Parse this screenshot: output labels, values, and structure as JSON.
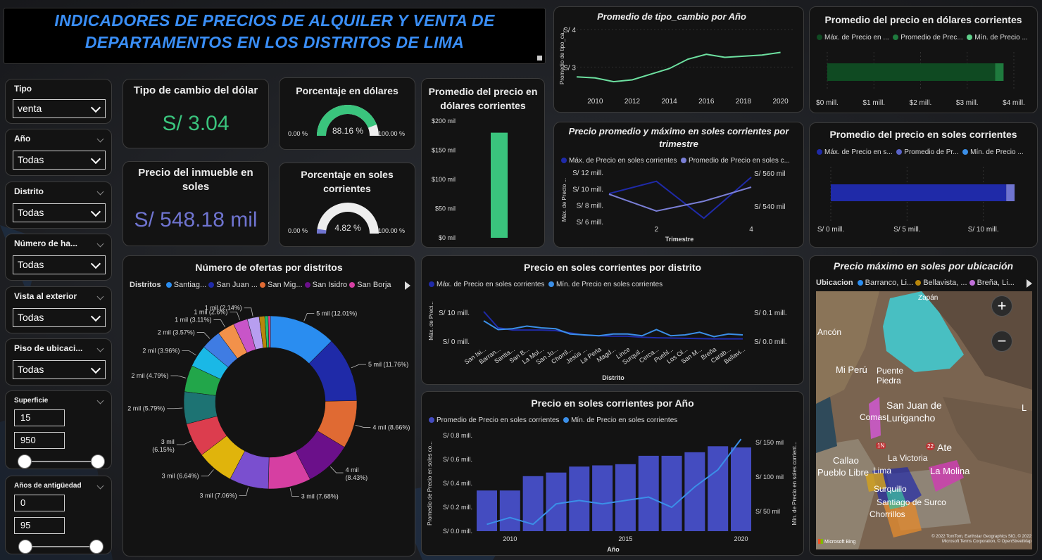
{
  "header": {
    "title_line1": "INDICADORES DE PRECIOS DE ALQUILER Y VENTA DE",
    "title_line2": "DEPARTAMENTOS EN LOS DISTRITOS DE LIMA"
  },
  "slicers": [
    {
      "label": "Tipo",
      "value": "venta"
    },
    {
      "label": "Año",
      "value": "Todas"
    },
    {
      "label": "Distrito",
      "value": "Todas"
    },
    {
      "label": "Número de ha...",
      "value": "Todas"
    },
    {
      "label": "Vista al exterior",
      "value": "Todas"
    },
    {
      "label": "Piso de ubicaci...",
      "value": "Todas"
    }
  ],
  "ranges": [
    {
      "label": "Superficie",
      "min": "15",
      "max": "950"
    },
    {
      "label": "Años de antigüedad",
      "min": "0",
      "max": "95"
    }
  ],
  "kpi": {
    "tc_title": "Tipo de cambio del dólar",
    "tc_value": "S/ 3.04",
    "price_title": "Precio del inmueble en soles",
    "price_value": "S/ 548.18 mil"
  },
  "gauges": {
    "usd": {
      "title": "Porcentaje en dólares",
      "value": "88.16 %",
      "fraction": 0.8816,
      "min": "0.00 %",
      "max": "100.00 %"
    },
    "pen": {
      "title": "Porcentaje en soles corrientes",
      "value": "4.82 %",
      "fraction": 0.0482,
      "min": "0.00 %",
      "max": "100.00 %"
    }
  },
  "colors": {
    "green": "#3ac47d",
    "blue": "#2e3bb5",
    "lightblue": "#3b8fe8",
    "purple": "#7a7fd6",
    "cyan": "#6de0a0"
  },
  "chart_data": [
    {
      "id": "usd_bar",
      "type": "bar",
      "title": "Promedio del precio en dólares corrientes",
      "yticks": [
        "$200 mil",
        "$150 mil",
        "$100 mil",
        "$50 mil",
        "$0 mil"
      ],
      "ylim": [
        0,
        200
      ],
      "values": [
        180
      ]
    },
    {
      "id": "tc_line",
      "type": "line",
      "title": "Promedio de tipo_cambio por Año",
      "ylabel": "Promedio de tipo_ca...",
      "yticks": [
        "S/ 4",
        "S/ 3"
      ],
      "ylim": [
        2.5,
        4
      ],
      "xticks": [
        "2010",
        "2012",
        "2014",
        "2016",
        "2018",
        "2020"
      ],
      "x": [
        2009,
        2010,
        2011,
        2012,
        2013,
        2014,
        2015,
        2016,
        2017,
        2018,
        2019,
        2020
      ],
      "y": [
        2.74,
        2.71,
        2.61,
        2.66,
        2.81,
        2.96,
        3.21,
        3.34,
        3.26,
        3.29,
        3.32,
        3.39
      ]
    },
    {
      "id": "usd_hbar",
      "type": "bar",
      "title": "Promedio del precio en dólares corrientes",
      "legend": [
        "Máx. de Precio en ...",
        "Promedio de Prec...",
        "Mín. de Precio ..."
      ],
      "xticks": [
        "$0 mill.",
        "$1 mill.",
        "$2 mill.",
        "$3 mill.",
        "$4 mill."
      ],
      "xlim": [
        0,
        4
      ],
      "values": [
        3.6,
        0.18
      ]
    },
    {
      "id": "trim_line",
      "type": "line",
      "title": "Precio promedio y máximo en soles corrientes por trimestre",
      "legend": [
        "Máx. de Precio en soles corrientes",
        "Promedio de Precio en soles c..."
      ],
      "xlabel": "Trimestre",
      "ylabel": "Máx. de Precio ...",
      "yticks_left": [
        "S/ 12 mill.",
        "S/ 10 mill.",
        "S/ 8 mill.",
        "S/ 6 mill."
      ],
      "yticks_right": [
        "S/ 560 mil",
        "S/ 540 mil"
      ],
      "xticks": [
        "2",
        "4"
      ],
      "x": [
        1,
        2,
        3,
        4
      ],
      "series": [
        {
          "name": "Máx. de Precio en soles corrientes",
          "values": [
            9.5,
            11,
            6.5,
            11.5
          ]
        },
        {
          "name": "Promedio de Precio en soles c...",
          "values": [
            550,
            538,
            545,
            555
          ]
        }
      ]
    },
    {
      "id": "pen_hbar",
      "type": "bar",
      "title": "Promedio del precio en soles corrientes",
      "legend": [
        "Máx. de Precio en s...",
        "Promedio de Pr...",
        "Mín. de Precio ..."
      ],
      "xticks": [
        "S/ 0 mill.",
        "S/ 5 mill.",
        "S/ 10 mill."
      ],
      "xlim": [
        0,
        12
      ],
      "values": [
        11.5,
        0.55
      ]
    },
    {
      "id": "donut",
      "type": "pie",
      "title": "Número de ofertas por distritos",
      "legend_title": "Distritos",
      "legend": [
        "Santiag...",
        "San Juan ...",
        "San Mig...",
        "San Isidro",
        "San Borja"
      ],
      "slices": [
        {
          "label": "5 mil (12.01%)",
          "value": 12.01,
          "color": "#2a8df0"
        },
        {
          "label": "5 mil (11.76%)",
          "value": 11.76,
          "color": "#1f2aa8"
        },
        {
          "label": "4 mil (8.66%)",
          "value": 8.66,
          "color": "#e06a33"
        },
        {
          "label": "4 mil (8.43%)",
          "value": 8.43,
          "color": "#6b108a"
        },
        {
          "label": "3 mil (7.68%)",
          "value": 7.68,
          "color": "#d63fa2"
        },
        {
          "label": "3 mil (7.06%)",
          "value": 7.06,
          "color": "#7a4fcf"
        },
        {
          "label": "3 mil (6.64%)",
          "value": 6.64,
          "color": "#e0b40c"
        },
        {
          "label": "3 mil (6.15%)",
          "value": 6.15,
          "color": "#dc3d4e"
        },
        {
          "label": "2 mil (5.79%)",
          "value": 5.79,
          "color": "#1d7373"
        },
        {
          "label": "2 mil (4.79%)",
          "value": 4.79,
          "color": "#22a64a"
        },
        {
          "label": "2 mil (3.96%)",
          "value": 3.96,
          "color": "#1ab8e6"
        },
        {
          "label": "2 mil (3.57%)",
          "value": 3.57,
          "color": "#3f7ce3"
        },
        {
          "label": "1 mil (3.11%)",
          "value": 3.11,
          "color": "#f2914a"
        },
        {
          "label": "1 mil (2.6%)",
          "value": 2.6,
          "color": "#c855c8"
        },
        {
          "label": "1 mil (2.14%)",
          "value": 2.14,
          "color": "#b79ef0"
        },
        {
          "label": "",
          "value": 1.0,
          "color": "#b8860b"
        },
        {
          "label": "",
          "value": 0.6,
          "color": "#20c070"
        },
        {
          "label": "",
          "value": 0.4,
          "color": "#e83e8c"
        }
      ]
    },
    {
      "id": "dist_line",
      "type": "line",
      "title": "Precio en soles corrientes por distrito",
      "legend": [
        "Máx. de Precio en soles corrientes",
        "Mín. de Precio en soles corrientes"
      ],
      "xlabel": "Distrito",
      "ylabel": "Máx. de Preci...",
      "yticks_left": [
        "S/ 10 mill.",
        "S/ 0 mill."
      ],
      "yticks_right": [
        "S/ 0.1 mill.",
        "S/ 0.0 mill."
      ],
      "categories": [
        "San Isi...",
        "Barran...",
        "Santia...",
        "San B...",
        "La Mol...",
        "San Ju...",
        "Chorril...",
        "Jesús ...",
        "La Perla",
        "Magd...",
        "Lince",
        "Surquil...",
        "Cerca...",
        "Puebl...",
        "Los Ol...",
        "San M...",
        "Breña",
        "Carab...",
        "Bellavi..."
      ],
      "series": [
        {
          "name": "Máx. de Precio en soles corrientes",
          "values": [
            11.8,
            5.5,
            4.6,
            4.6,
            4.6,
            4.4,
            3.5,
            2.6,
            2.4,
            2.2,
            2.2,
            1.8,
            1.6,
            1.5,
            1.4,
            1.3,
            1.2,
            1.2,
            1.2
          ]
        },
        {
          "name": "Mín. de Precio en soles corrientes",
          "values": [
            0.12,
            0.07,
            0.075,
            0.09,
            0.08,
            0.075,
            0.045,
            0.04,
            0.035,
            0.045,
            0.045,
            0.035,
            0.07,
            0.035,
            0.04,
            0.055,
            0.03,
            0.045,
            0.04
          ]
        }
      ]
    },
    {
      "id": "year_combo",
      "type": "bar",
      "title": "Precio en soles corrientes por Año",
      "legend": [
        "Promedio de Precio en soles corrientes",
        "Mín. de Precio en soles corrientes"
      ],
      "xlabel": "Año",
      "ylabel_left": "Promedio de Precio en soles co...",
      "ylabel_right": "Mín. de Precio en soles corrient...",
      "yticks_left": [
        "S/ 0.8 mill.",
        "S/ 0.6 mill.",
        "S/ 0.4 mill.",
        "S/ 0.2 mill.",
        "S/ 0.0 mill."
      ],
      "yticks_right": [
        "S/ 150 mil",
        "S/ 100 mil",
        "S/ 50 mil"
      ],
      "xticks": [
        "2010",
        "2015",
        "2020"
      ],
      "x": [
        2009,
        2010,
        2011,
        2012,
        2013,
        2014,
        2015,
        2016,
        2017,
        2018,
        2019,
        2020
      ],
      "series": [
        {
          "name": "Promedio de Precio en soles corrientes",
          "values": [
            0.34,
            0.34,
            0.46,
            0.49,
            0.54,
            0.55,
            0.56,
            0.63,
            0.63,
            0.66,
            0.71,
            0.7
          ]
        },
        {
          "name": "Mín. de Precio en soles corrientes",
          "values": [
            30,
            40,
            30,
            60,
            65,
            60,
            65,
            70,
            55,
            85,
            110,
            155
          ]
        }
      ]
    }
  ],
  "map": {
    "title": "Precio máximo en soles por ubicación",
    "legend_title": "Ubicacion",
    "legend": [
      "Barranco, Li...",
      "Bellavista, ...",
      "Breña, Li..."
    ],
    "places": [
      "Zapán",
      "Ancón",
      "Mi Perú",
      "Puente Piedra",
      "San Juan de Lurigancho",
      "Comas",
      "Callao",
      "Ate",
      "La Victoria",
      "Pueblo Libre",
      "Lima",
      "La Molina",
      "Surquillo",
      "Santiago de Surco",
      "Chorrillos",
      "L"
    ],
    "route_numbers": [
      "1N",
      "22"
    ],
    "attribution": "© 2022 TomTom, Earthstar Geographics SIO, © 2022 Microsoft Terms Corporation, © OpenStreetMap",
    "brand": "Microsoft Bing"
  }
}
